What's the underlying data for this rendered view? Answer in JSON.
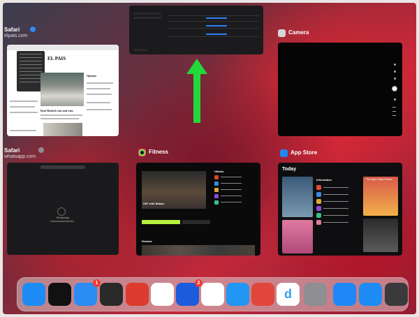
{
  "app_switcher": {
    "cards": {
      "safari_elpais": {
        "app": "Safari",
        "subtitle": "elpais.com",
        "page_logo": "EL PAIS",
        "side_heading": "Opinion",
        "headline": "Real Madrid wins and wins"
      },
      "camera": {
        "app": "Camera"
      },
      "safari_whatsapp": {
        "app": "Safari",
        "subtitle": "whatsapp.com",
        "body_text": "WhatsApp"
      },
      "fitness": {
        "app": "Fitness",
        "video_title": "HIIT with Bakari",
        "list_heading": "Hitlists",
        "bottom_heading": "Related"
      },
      "app_store": {
        "app": "App Store",
        "header": "Today",
        "featured_title": "The Apple Maps Games",
        "list_heading": "Information"
      }
    }
  },
  "dock": {
    "items": [
      {
        "name": "Safari",
        "icon": "compass-icon",
        "color": "#1e8cf5"
      },
      {
        "name": "Fitness",
        "icon": "rings-icon",
        "color": "#111111"
      },
      {
        "name": "Mail",
        "icon": "envelope-icon",
        "color": "#2b8cf6",
        "badge": "1"
      },
      {
        "name": "Tes",
        "icon": "butterfly-icon",
        "color": "#2a2a2a"
      },
      {
        "name": "Bear",
        "icon": "bear-icon",
        "color": "#dd3b2e"
      },
      {
        "name": "Notes",
        "icon": "pen-icon",
        "color": "#ffffff"
      },
      {
        "name": "Reminders",
        "icon": "checkbox-icon",
        "color": "#1c5bdc",
        "badge": "2"
      },
      {
        "name": "Photos",
        "icon": "flower-icon",
        "color": "#ffffff"
      },
      {
        "name": "Files",
        "icon": "folder-icon",
        "color": "#2196f3"
      },
      {
        "name": "Reeder",
        "icon": "bolt-icon",
        "color": "#e0473a"
      },
      {
        "name": "Dictionary",
        "icon": "letter-d-icon",
        "color": "#ffffff",
        "glyph": "d"
      },
      {
        "name": "Settings",
        "icon": "gear-icon",
        "color": "#8e8e93"
      },
      {
        "name": "App Store",
        "icon": "appstore-icon",
        "color": "#1f88f7"
      },
      {
        "name": "Safari",
        "icon": "compass-icon",
        "color": "#1e8cf5"
      },
      {
        "name": "App Library",
        "icon": "grid-icon",
        "color": "#3a3a3c"
      }
    ]
  },
  "colors": {
    "gesture_arrow": "#22d83a",
    "accent_link": "#2f7cf6",
    "fitness_green": "#b6f03d"
  }
}
